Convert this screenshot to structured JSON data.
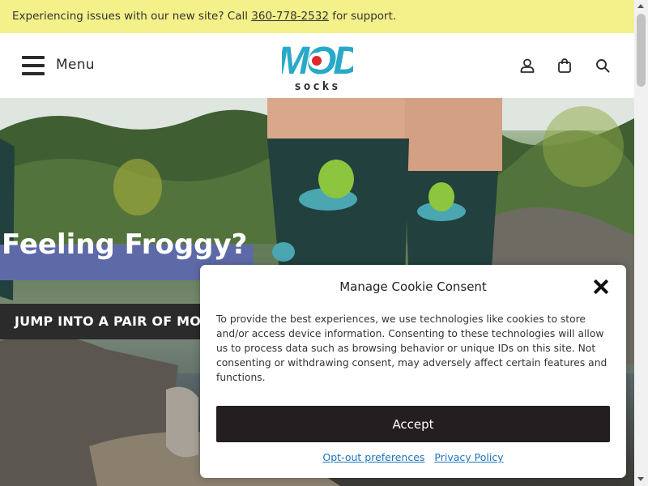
{
  "announcement": {
    "text_before": "Experiencing issues with our new site? Call ",
    "phone": "360-778-2532",
    "text_after": " for support.",
    "background": "#f4f08a"
  },
  "header": {
    "menu_label": "Menu",
    "logo_alt": "MOD socks",
    "logo_top": "MOD",
    "logo_bottom": "socks",
    "icons": [
      "account-icon",
      "cart-icon",
      "search-icon"
    ]
  },
  "hero": {
    "title": "Feeling Froggy?",
    "cta": "JUMP INTO A PAIR OF MOD",
    "title_bg": "#5e6aa8",
    "cta_bg": "#2b2b2b"
  },
  "cookie_modal": {
    "title": "Manage Cookie Consent",
    "body": "To provide the best experiences, we use technologies like cookies to store and/or access device information. Consenting to these technologies will allow us to process data such as browsing behavior or unique IDs on this site. Not consenting or withdrawing consent, may adversely affect certain features and functions.",
    "accept_label": "Accept",
    "optout_label": "Opt-out preferences",
    "privacy_label": "Privacy Policy",
    "accent": "#231f20",
    "link_color": "#1e73be"
  }
}
